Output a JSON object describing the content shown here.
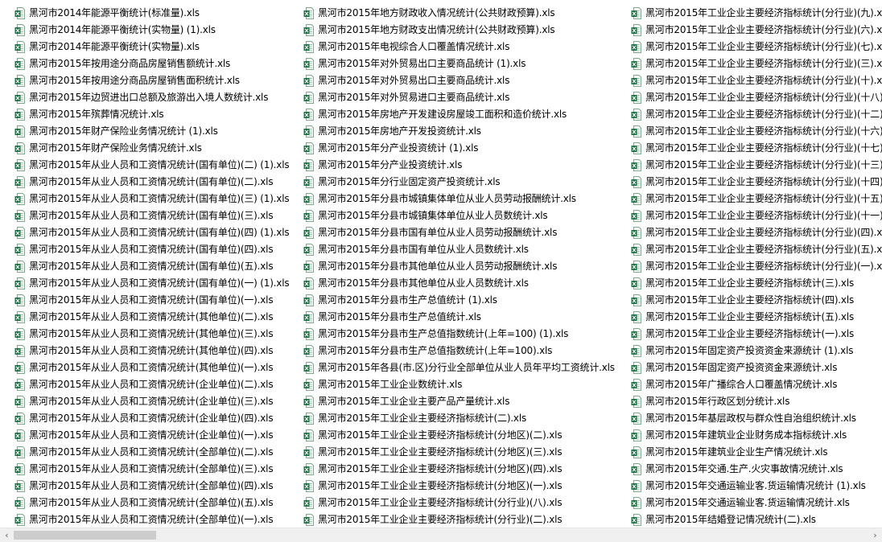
{
  "icon": "excel-file-icon",
  "colors": {
    "icon_green": "#1d7044",
    "icon_border": "#7fa88c",
    "thumb": "#cdcdcd",
    "track": "#f0f0f0"
  },
  "scrollbar": {
    "left_arrow": "‹",
    "right_arrow": "›"
  },
  "columns": [
    [
      "黑河市2014年能源平衡统计(标准量).xls",
      "黑河市2014年能源平衡统计(实物量) (1).xls",
      "黑河市2014年能源平衡统计(实物量).xls",
      "黑河市2015年按用途分商品房屋销售额统计.xls",
      "黑河市2015年按用途分商品房屋销售面积统计.xls",
      "黑河市2015年边贸进出口总额及旅游出入境人数统计.xls",
      "黑河市2015年殡葬情况统计.xls",
      "黑河市2015年财产保险业务情况统计 (1).xls",
      "黑河市2015年财产保险业务情况统计.xls",
      "黑河市2015年从业人员和工资情况统计(国有单位)(二) (1).xls",
      "黑河市2015年从业人员和工资情况统计(国有单位)(二).xls",
      "黑河市2015年从业人员和工资情况统计(国有单位)(三) (1).xls",
      "黑河市2015年从业人员和工资情况统计(国有单位)(三).xls",
      "黑河市2015年从业人员和工资情况统计(国有单位)(四) (1).xls",
      "黑河市2015年从业人员和工资情况统计(国有单位)(四).xls",
      "黑河市2015年从业人员和工资情况统计(国有单位)(五).xls",
      "黑河市2015年从业人员和工资情况统计(国有单位)(一) (1).xls",
      "黑河市2015年从业人员和工资情况统计(国有单位)(一).xls",
      "黑河市2015年从业人员和工资情况统计(其他单位)(二).xls",
      "黑河市2015年从业人员和工资情况统计(其他单位)(三).xls",
      "黑河市2015年从业人员和工资情况统计(其他单位)(四).xls",
      "黑河市2015年从业人员和工资情况统计(其他单位)(一).xls",
      "黑河市2015年从业人员和工资情况统计(企业单位)(二).xls",
      "黑河市2015年从业人员和工资情况统计(企业单位)(三).xls",
      "黑河市2015年从业人员和工资情况统计(企业单位)(四).xls",
      "黑河市2015年从业人员和工资情况统计(企业单位)(一).xls",
      "黑河市2015年从业人员和工资情况统计(全部单位)(二).xls",
      "黑河市2015年从业人员和工资情况统计(全部单位)(三).xls",
      "黑河市2015年从业人员和工资情况统计(全部单位)(四).xls",
      "黑河市2015年从业人员和工资情况统计(全部单位)(五).xls",
      "黑河市2015年从业人员和工资情况统计(全部单位)(一).xls"
    ],
    [
      "黑河市2015年地方财政收入情况统计(公共财政预算).xls",
      "黑河市2015年地方财政支出情况统计(公共财政预算).xls",
      "黑河市2015年电视综合人口覆盖情况统计.xls",
      "黑河市2015年对外贸易出口主要商品统计 (1).xls",
      "黑河市2015年对外贸易出口主要商品统计.xls",
      "黑河市2015年对外贸易进口主要商品统计.xls",
      "黑河市2015年房地产开发建设房屋竣工面积和造价统计.xls",
      "黑河市2015年房地产开发投资统计.xls",
      "黑河市2015年分产业投资统计 (1).xls",
      "黑河市2015年分产业投资统计.xls",
      "黑河市2015年分行业固定资产投资统计.xls",
      "黑河市2015年分县市城镇集体单位从业人员劳动报酬统计.xls",
      "黑河市2015年分县市城镇集体单位从业人员数统计.xls",
      "黑河市2015年分县市国有单位从业人员劳动报酬统计.xls",
      "黑河市2015年分县市国有单位从业人员数统计.xls",
      "黑河市2015年分县市其他单位从业人员劳动报酬统计.xls",
      "黑河市2015年分县市其他单位从业人员数统计.xls",
      "黑河市2015年分县市生产总值统计 (1).xls",
      "黑河市2015年分县市生产总值统计.xls",
      "黑河市2015年分县市生产总值指数统计(上年=100) (1).xls",
      "黑河市2015年分县市生产总值指数统计(上年=100).xls",
      "黑河市2015年各县(市.区)分行业全部单位从业人员年平均工资统计.xls",
      "黑河市2015年工业企业数统计.xls",
      "黑河市2015年工业企业主要产品产量统计.xls",
      "黑河市2015年工业企业主要经济指标统计(二).xls",
      "黑河市2015年工业企业主要经济指标统计(分地区)(二).xls",
      "黑河市2015年工业企业主要经济指标统计(分地区)(三).xls",
      "黑河市2015年工业企业主要经济指标统计(分地区)(四).xls",
      "黑河市2015年工业企业主要经济指标统计(分地区)(一).xls",
      "黑河市2015年工业企业主要经济指标统计(分行业)(八).xls",
      "黑河市2015年工业企业主要经济指标统计(分行业)(二).xls"
    ],
    [
      "黑河市2015年工业企业主要经济指标统计(分行业)(九).xls",
      "黑河市2015年工业企业主要经济指标统计(分行业)(六).xls",
      "黑河市2015年工业企业主要经济指标统计(分行业)(七).xls",
      "黑河市2015年工业企业主要经济指标统计(分行业)(三).xls",
      "黑河市2015年工业企业主要经济指标统计(分行业)(十).xls",
      "黑河市2015年工业企业主要经济指标统计(分行业)(十八).xls",
      "黑河市2015年工业企业主要经济指标统计(分行业)(十二).xls",
      "黑河市2015年工业企业主要经济指标统计(分行业)(十六).xls",
      "黑河市2015年工业企业主要经济指标统计(分行业)(十七).xls",
      "黑河市2015年工业企业主要经济指标统计(分行业)(十三).xls",
      "黑河市2015年工业企业主要经济指标统计(分行业)(十四).xls",
      "黑河市2015年工业企业主要经济指标统计(分行业)(十五).xls",
      "黑河市2015年工业企业主要经济指标统计(分行业)(十一).xls",
      "黑河市2015年工业企业主要经济指标统计(分行业)(四).xls",
      "黑河市2015年工业企业主要经济指标统计(分行业)(五).xls",
      "黑河市2015年工业企业主要经济指标统计(分行业)(一).xls",
      "黑河市2015年工业企业主要经济指标统计(三).xls",
      "黑河市2015年工业企业主要经济指标统计(四).xls",
      "黑河市2015年工业企业主要经济指标统计(五).xls",
      "黑河市2015年工业企业主要经济指标统计(一).xls",
      "黑河市2015年固定资产投资资金来源统计 (1).xls",
      "黑河市2015年固定资产投资资金来源统计.xls",
      "黑河市2015年广播综合人口覆盖情况统计.xls",
      "黑河市2015年行政区划分统计.xls",
      "黑河市2015年基层政权与群众性自治组织统计.xls",
      "黑河市2015年建筑业企业财务成本指标统计.xls",
      "黑河市2015年建筑业企业生产情况统计.xls",
      "黑河市2015年交通.生产.火灾事故情况统计.xls",
      "黑河市2015年交通运输业客.货运输情况统计 (1).xls",
      "黑河市2015年交通运输业客.货运输情况统计.xls",
      "黑河市2015年结婚登记情况统计(二).xls"
    ]
  ]
}
